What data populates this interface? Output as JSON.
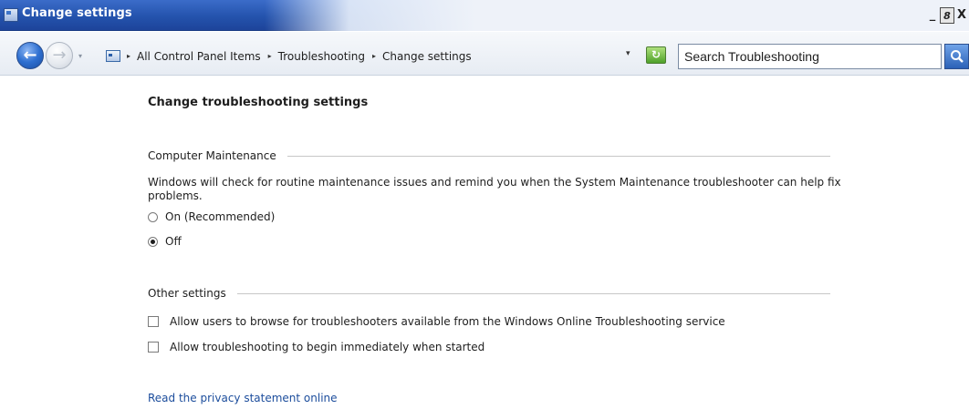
{
  "window": {
    "title": "Change settings",
    "controls": {
      "minimize": "_",
      "restore": "8",
      "close": "X"
    }
  },
  "navigation": {
    "back_glyph": "←",
    "forward_glyph": "→",
    "dropdown_glyph": "▾",
    "breadcrumbs": [
      "All Control Panel Items",
      "Troubleshooting",
      "Change settings"
    ],
    "breadcrumb_separator": "▸",
    "address_dropdown": "▾",
    "refresh_glyph": "↻",
    "search_placeholder": "Search Troubleshooting",
    "search_icon": "search-icon"
  },
  "main": {
    "heading": "Change troubleshooting settings",
    "computer_maintenance": {
      "label": "Computer Maintenance",
      "description": "Windows will check for routine maintenance issues and remind you when the System Maintenance troubleshooter can help fix problems.",
      "options": [
        {
          "label": "On (Recommended)",
          "selected": false
        },
        {
          "label": "Off",
          "selected": true
        }
      ]
    },
    "other_settings": {
      "label": "Other settings",
      "checkboxes": [
        {
          "label": "Allow users to browse for troubleshooters available from the Windows Online Troubleshooting service",
          "checked": false
        },
        {
          "label": "Allow troubleshooting to begin immediately when started",
          "checked": false
        }
      ]
    },
    "privacy_link": "Read the privacy statement online"
  },
  "colors": {
    "titlebar": "#2453ad",
    "link": "#1c4d9c",
    "refresh": "#4fa12a"
  }
}
